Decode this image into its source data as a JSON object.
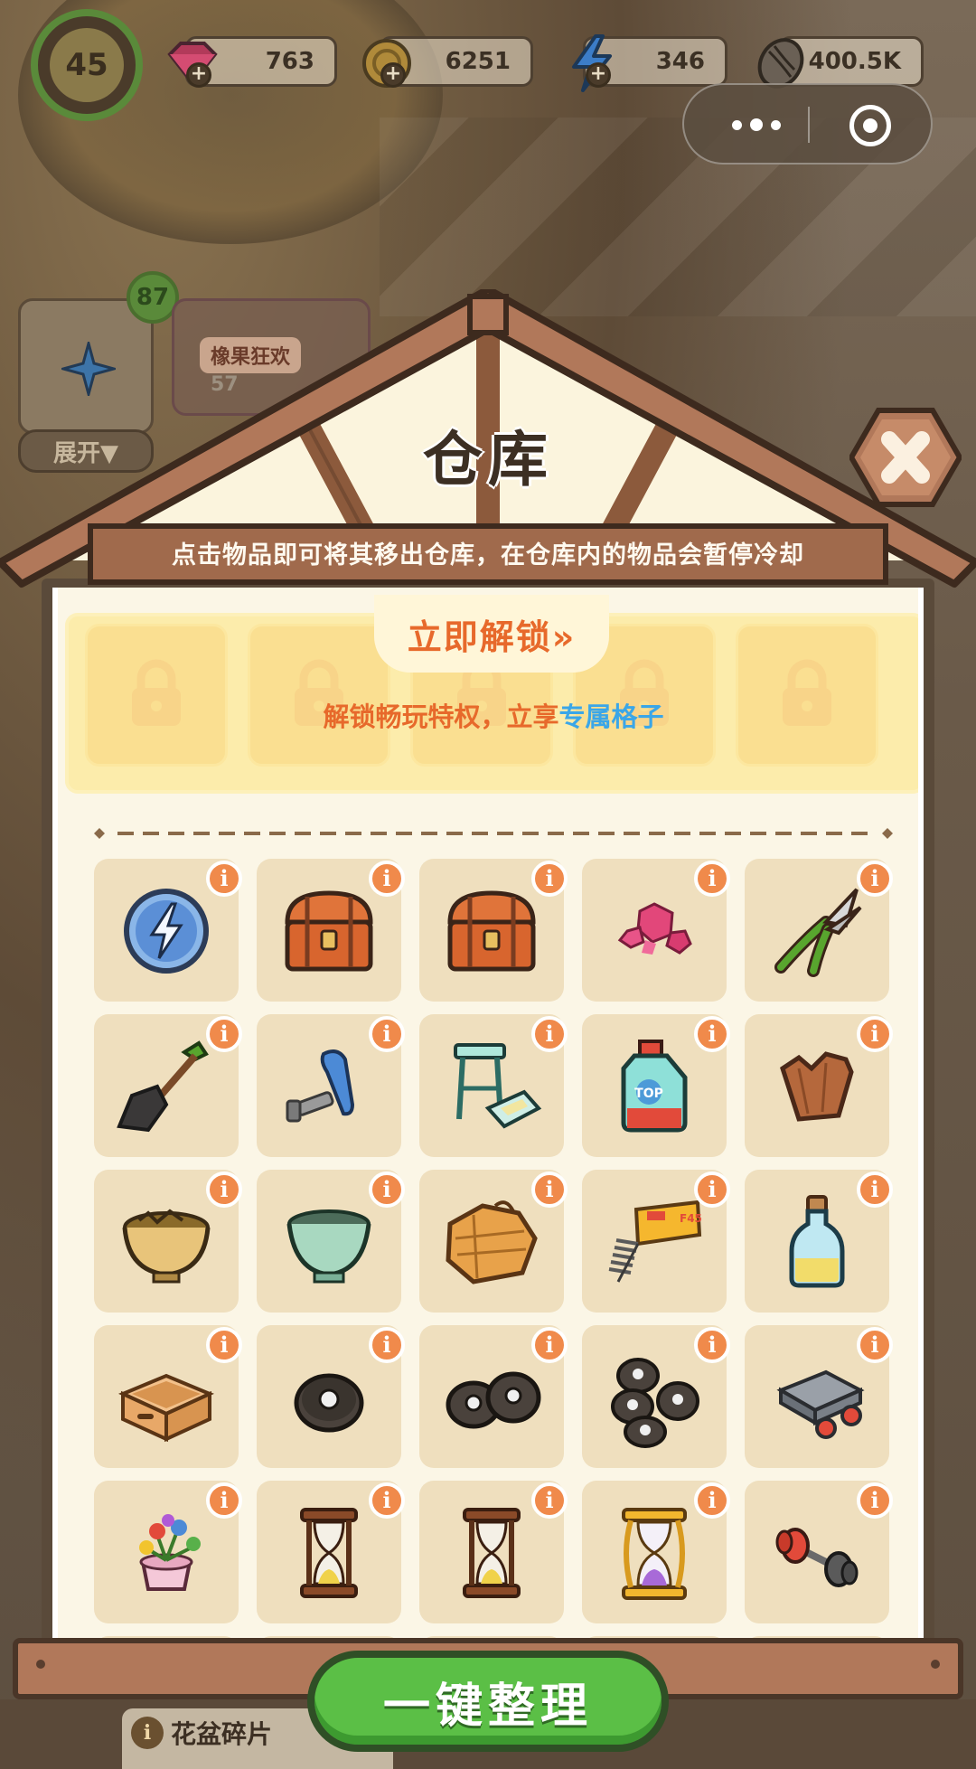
{
  "hud": {
    "level": "45",
    "gems": "763",
    "coins": "6251",
    "energy": "346",
    "seeds": "400.5K"
  },
  "left_panel": {
    "badge_count": "87",
    "expand_label": "展开▼",
    "event_name": "橡果狂欢",
    "event_progress": "57"
  },
  "warehouse": {
    "title": "仓库",
    "subtitle": "点击物品即可将其移出仓库，在仓库内的物品会暂停冷却",
    "unlock_button": "立即解锁»",
    "unlock_desc_prefix": "解锁畅玩特权，立享",
    "unlock_desc_highlight": "专属格子",
    "info_glyph": "i",
    "items": [
      {
        "icon": "energy-orb-icon"
      },
      {
        "icon": "treasure-chest-icon"
      },
      {
        "icon": "treasure-chest-icon"
      },
      {
        "icon": "pink-gems-icon"
      },
      {
        "icon": "pruning-shears-icon"
      },
      {
        "icon": "shovel-icon"
      },
      {
        "icon": "screw-bolt-icon"
      },
      {
        "icon": "stool-tray-icon"
      },
      {
        "icon": "detergent-bottle-icon"
      },
      {
        "icon": "broken-pot-shard-icon"
      },
      {
        "icon": "broken-bowl-icon"
      },
      {
        "icon": "green-flowerpot-icon"
      },
      {
        "icon": "burlap-sacks-icon"
      },
      {
        "icon": "staples-box-icon"
      },
      {
        "icon": "glass-bottle-icon"
      },
      {
        "icon": "wooden-crate-icon"
      },
      {
        "icon": "single-wheel-icon"
      },
      {
        "icon": "two-wheels-icon"
      },
      {
        "icon": "four-wheels-icon"
      },
      {
        "icon": "cart-base-icon"
      },
      {
        "icon": "flower-pot-plant-icon"
      },
      {
        "icon": "hourglass-icon"
      },
      {
        "icon": "hourglass-icon"
      },
      {
        "icon": "golden-hourglass-icon"
      },
      {
        "icon": "dumbbell-icon"
      }
    ]
  },
  "bottom": {
    "sort_button": "一键整理",
    "hint_title": "花盆碎片",
    "hint_glyph": "i"
  },
  "colors": {
    "accent_orange": "#e7692b",
    "highlight_blue": "#3aa6e8",
    "sort_green": "#5bbf46",
    "info_badge": "#f08a4b",
    "wood": "#b1785a"
  }
}
